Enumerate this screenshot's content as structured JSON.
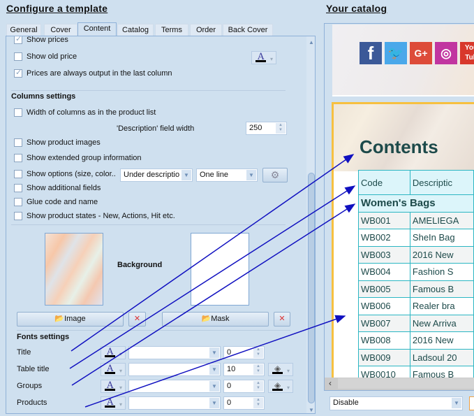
{
  "left": {
    "title": "Configure a template",
    "tabs": [
      "General",
      "Cover",
      "Content",
      "Catalog",
      "Terms",
      "Order",
      "Back Cover"
    ],
    "active_tab": "Content",
    "price_options": [
      {
        "label": "Show prices",
        "checked": true
      },
      {
        "label": "Show old price",
        "checked": false
      },
      {
        "label": "Prices are always output in the last column",
        "checked": true
      }
    ],
    "columns": {
      "title": "Columns settings",
      "width_as_list": "Width of columns as in the product list",
      "desc_width_label": "'Description' field width",
      "desc_width_value": "250",
      "show_images": "Show product images",
      "show_extended": "Show extended group information",
      "show_options": "Show options (size, color..",
      "options_position": "Under descriptio",
      "options_lines": "One line",
      "show_additional": "Show additional fields",
      "glue": "Glue code and name",
      "show_states": "Show product states - New, Actions, Hit etc."
    },
    "background": {
      "label": "Background",
      "image_button": "Image",
      "mask_button": "Mask"
    },
    "fonts": {
      "title": "Fonts settings",
      "rows": [
        {
          "label": "Title",
          "font": "",
          "size": "0",
          "fill": false
        },
        {
          "label": "Table title",
          "font": "",
          "size": "10",
          "fill": true
        },
        {
          "label": "Groups",
          "font": "",
          "size": "0",
          "fill": true
        },
        {
          "label": "Products",
          "font": "",
          "size": "0",
          "fill": false
        }
      ]
    }
  },
  "right": {
    "title": "Your catalog",
    "social": [
      "facebook",
      "twitter",
      "google-plus",
      "instagram",
      "youtube"
    ],
    "contents_title": "Contents",
    "table": {
      "headers": [
        "Code",
        "Descriptic"
      ],
      "group": "Women's Bags",
      "rows": [
        [
          "WB001",
          "AMELIEGA"
        ],
        [
          "WB002",
          "SheIn Bag"
        ],
        [
          "WB003",
          "2016 New"
        ],
        [
          "WB004",
          "Fashion S"
        ],
        [
          "WB005",
          "Famous B"
        ],
        [
          "WB006",
          "Realer bra"
        ],
        [
          "WB007",
          "New Arriva"
        ],
        [
          "WB008",
          "2016 New"
        ],
        [
          "WB009",
          "Ladsoul 20"
        ],
        [
          "WB0010",
          "Famous B"
        ]
      ]
    },
    "bottom_select": "Disable"
  },
  "colors": {
    "bg": "#cfe0ef",
    "arrow": "#1010c0",
    "table_border": "#2bb6c3",
    "contents_text": "#1d4a4a"
  }
}
